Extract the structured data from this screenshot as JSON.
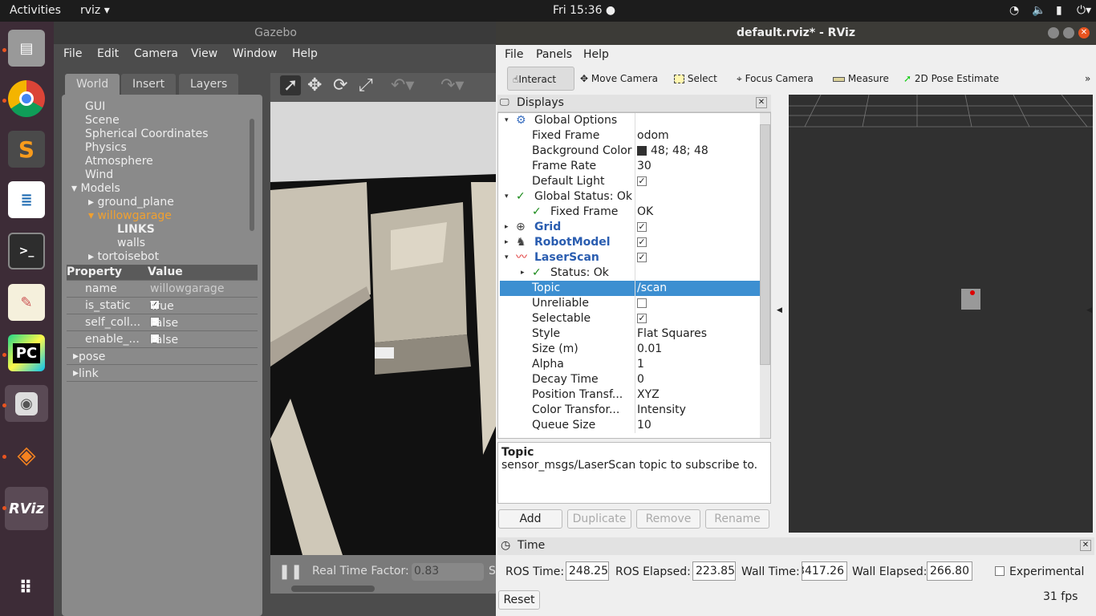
{
  "topbar": {
    "activities": "Activities",
    "app": "rviz ▾",
    "clock": "Fri 15:36 ●"
  },
  "dock": {
    "items": [
      "file-manager",
      "chrome",
      "sublime",
      "writer",
      "terminal",
      "text-editor",
      "pycharm",
      "speaker",
      "blender",
      "rviz",
      "app-grid"
    ]
  },
  "gazebo": {
    "title": "Gazebo",
    "menu": [
      "File",
      "Edit",
      "Camera",
      "View",
      "Window",
      "Help"
    ],
    "tabs": [
      "World",
      "Insert",
      "Layers"
    ],
    "tree": [
      "GUI",
      "Scene",
      "Spherical Coordinates",
      "Physics",
      "Atmosphere",
      "Wind",
      "Models",
      "ground_plane",
      "willowgarage",
      "LINKS",
      "walls",
      "tortoisebot"
    ],
    "props_header": [
      "Property",
      "Value"
    ],
    "props": [
      [
        "name",
        "willowgarage"
      ],
      [
        "is_static",
        "True"
      ],
      [
        "self_coll...",
        "False"
      ],
      [
        "enable_...",
        "False"
      ]
    ],
    "expand": [
      "pose",
      "link"
    ],
    "rtf_label": "Real Time Factor:",
    "rtf_value": "0.83",
    "sim_partial": "Si"
  },
  "rviz": {
    "title": "default.rviz* - RViz",
    "menu": [
      "File",
      "Panels",
      "Help"
    ],
    "tools": [
      "Interact",
      "Move Camera",
      "Select",
      "Focus Camera",
      "Measure",
      "2D Pose Estimate"
    ],
    "more": "»",
    "displays_title": "Displays",
    "rows": [
      [
        "Global Options",
        ""
      ],
      [
        "Fixed Frame",
        "odom"
      ],
      [
        "Background Color",
        "48; 48; 48"
      ],
      [
        "Frame Rate",
        "30"
      ],
      [
        "Default Light",
        "✓"
      ],
      [
        "Global Status: Ok",
        ""
      ],
      [
        "Fixed Frame",
        "OK"
      ],
      [
        "Grid",
        "✓"
      ],
      [
        "RobotModel",
        "✓"
      ],
      [
        "LaserScan",
        "✓"
      ],
      [
        "Status: Ok",
        ""
      ],
      [
        "Topic",
        "/scan"
      ],
      [
        "Unreliable",
        ""
      ],
      [
        "Selectable",
        "✓"
      ],
      [
        "Style",
        "Flat Squares"
      ],
      [
        "Size (m)",
        "0.01"
      ],
      [
        "Alpha",
        "1"
      ],
      [
        "Decay Time",
        "0"
      ],
      [
        "Position Transf...",
        "XYZ"
      ],
      [
        "Color Transfor...",
        "Intensity"
      ],
      [
        "Queue Size",
        "10"
      ]
    ],
    "help_title": "Topic",
    "help_text": "sensor_msgs/LaserScan topic to subscribe to.",
    "buttons": [
      "Add",
      "Duplicate",
      "Remove",
      "Rename"
    ],
    "time_title": "Time",
    "ros_time_label": "ROS Time:",
    "ros_time": "248.25",
    "ros_elapsed_label": "ROS Elapsed:",
    "ros_elapsed": "223.85",
    "wall_time_label": "Wall Time:",
    "wall_time": "3417.26",
    "wall_elapsed_label": "Wall Elapsed:",
    "wall_elapsed": "266.80",
    "experimental": "Experimental",
    "reset": "Reset",
    "fps": "31 fps",
    "background_color": "#303030",
    "accent": "#3d8fd1"
  }
}
